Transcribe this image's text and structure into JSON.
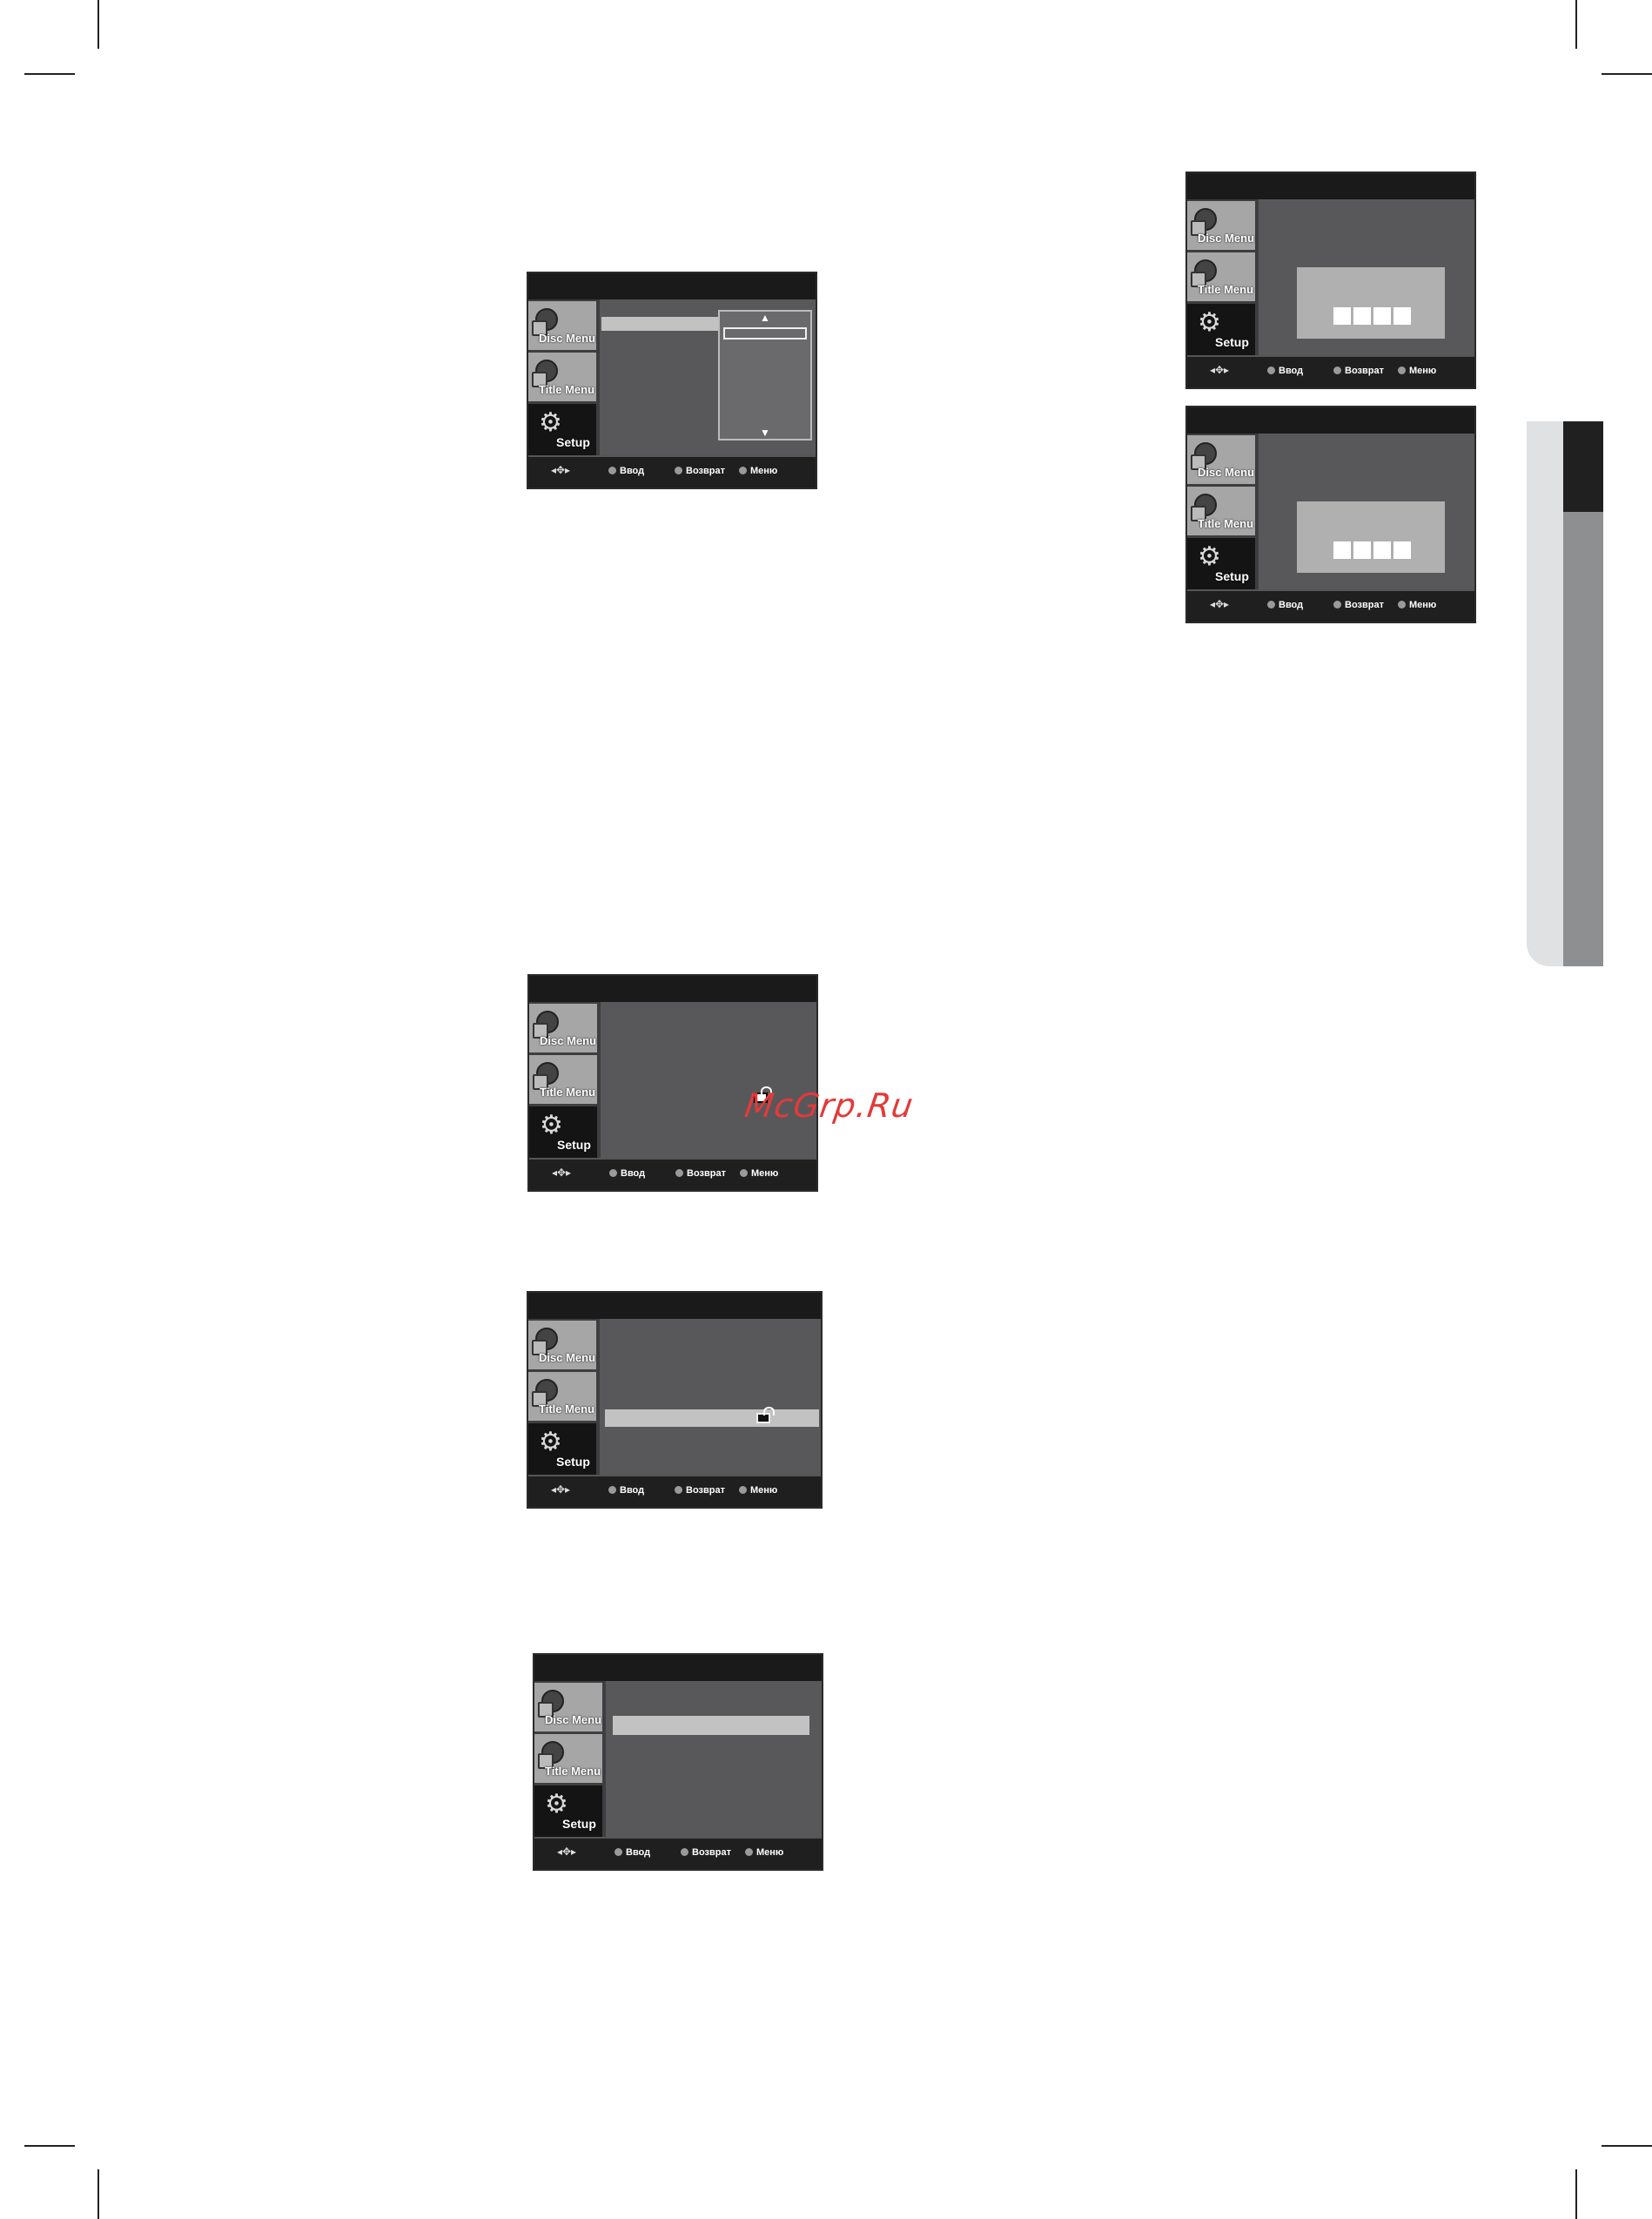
{
  "osd": {
    "disc_menu": "Disc Menu",
    "title_menu": "Title Menu",
    "setup": "Setup",
    "hint_enter": "Ввод",
    "hint_return": "Возврат",
    "hint_menu": "Меню"
  },
  "watermark": "McGrp.Ru",
  "colors": {
    "panel": "#58585a",
    "topbar": "#1a1a1a",
    "highlight": "#c2c2c2",
    "tab_dark": "#202020",
    "watermark": "#e23a3a"
  }
}
